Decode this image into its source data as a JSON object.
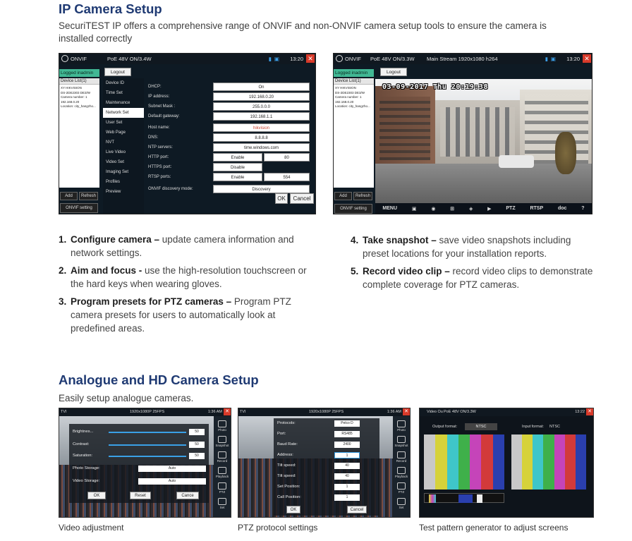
{
  "ip_section": {
    "title": "IP Camera Setup",
    "intro_line1": "SecuriTEST IP offers a comprehensive range of ONVIF and non-ONVIF camera setup tools to ensure the camera is",
    "intro_line2": "installed correctly"
  },
  "screen_left": {
    "app_name": "ONVIF",
    "poe": "PoE 48V ON/3.4W",
    "time": "13:20",
    "logged_in": "Logged inadmin",
    "logout": "Logout",
    "device_list_header": "Device List(1)",
    "device_info": [
      "XY HIKVISION",
      "DS-2DE2303 DE3/W",
      "Camera number: 1",
      "192.168.0.20",
      "Location: city_hangzho..."
    ],
    "add": "Add",
    "refresh": "Refresh",
    "onvif_setting": "ONVIF setting",
    "menu": [
      {
        "label": "Device ID"
      },
      {
        "label": "Time Set"
      },
      {
        "label": "Maintenance"
      },
      {
        "label": "Network Set"
      },
      {
        "label": "User Set"
      },
      {
        "label": "Web Page"
      },
      {
        "label": "NVT"
      },
      {
        "label": "Live Video"
      },
      {
        "label": "Video Set"
      },
      {
        "label": "Imaging Set"
      },
      {
        "label": "Profiles"
      },
      {
        "label": "Preview"
      }
    ],
    "form": {
      "dhcp_label": "DHCP:",
      "dhcp_value": "On",
      "ip_label": "IP address:",
      "ip_value": "192.168.0.20",
      "mask_label": "Subnet Mask :",
      "mask_value": "255.0.0.0",
      "gw_label": "Default gateway:",
      "gw_value": "192.168.1.1",
      "host_label": "Host name:",
      "host_value": "hikvision",
      "dns_label": "DNS:",
      "dns_value": "8.8.8.8",
      "ntp_label": "NTP servers:",
      "ntp_value": "time.windows.com",
      "http_label": "HTTP port:",
      "http_state": "Enable",
      "http_port": "80",
      "https_label": "HTTPS port:",
      "https_state": "Disable",
      "rtsp_label": "RTSP ports:",
      "rtsp_state": "Enable",
      "rtsp_port": "554",
      "disc_label": "ONVIF discovery mode:",
      "disc_value": "Discovery"
    },
    "ok": "OK",
    "cancel": "Cancel"
  },
  "screen_right": {
    "app_name": "ONVIF",
    "poe": "PoE 48V ON/3.3W",
    "stream": "Main Stream 1920x1080 h264",
    "time": "13:20",
    "logged_in": "Logged inadmin",
    "logout": "Logout",
    "device_list_header": "Device List(1)",
    "device_info": [
      "XY HIKVISION",
      "DS-2DE2303 DE3/W",
      "Camera number: 1",
      "192.168.0.20",
      "Location: city_hangzho..."
    ],
    "timestamp": "03-09-2017 Thu 20:19:38",
    "add": "Add",
    "refresh": "Refresh",
    "onvif_setting": "ONVIF setting",
    "toolbar": [
      "MENU",
      "▣",
      "◉",
      "⊞",
      "◈",
      "▶",
      "PTZ",
      "RTSP",
      "doc",
      "?"
    ]
  },
  "steps_left": [
    {
      "num": "1.",
      "title": "Configure camera –",
      "text": " update camera information and network settings."
    },
    {
      "num": "2.",
      "title": "Aim and focus -",
      "text": " use the high-resolution touchscreen or the hard keys when wearing gloves."
    },
    {
      "num": "3.",
      "title": "Program presets for PTZ cameras –",
      "text": " Program PTZ camera presets for users to automatically look at predefined areas."
    }
  ],
  "steps_right": [
    {
      "num": "4.",
      "title": "Take snapshot –",
      "text": " save video snapshots including preset locations for your installation reports."
    },
    {
      "num": "5.",
      "title": "Record video clip –",
      "text": " record video clips to demonstrate complete coverage for PTZ cameras."
    }
  ],
  "analogue_section": {
    "title": "Analogue and HD Camera Setup",
    "intro": "Easily setup analogue cameras."
  },
  "thumb1": {
    "mode": "TVI",
    "res": "1920x1080P 25FPS",
    "time": "1:36 AM",
    "rows": [
      {
        "label": "Brightnes...",
        "value": "50"
      },
      {
        "label": "Contrast:",
        "value": "50"
      },
      {
        "label": "Saturation:",
        "value": "50"
      }
    ],
    "photo_label": "Photo Storage:",
    "photo_value": "Auto",
    "video_label": "Video Storage:",
    "video_value": "Auto",
    "ok": "OK",
    "reset": "Reset",
    "cancel": "Cance",
    "side": [
      "Photo",
      "Snapshot",
      "Record",
      "Playback",
      "PTZ",
      "Set"
    ],
    "caption": "Video adjustment"
  },
  "thumb2": {
    "mode": "TVI",
    "res": "1920x1080P 25FPS",
    "time": "1:36 AM",
    "rows": [
      {
        "label": "Protocols:",
        "value": "Pelco D"
      },
      {
        "label": "Port:",
        "value": "RS485"
      },
      {
        "label": "Baud Rate:",
        "value": "2400"
      },
      {
        "label": "Address:",
        "value": "1"
      },
      {
        "label": "Tilt speed:",
        "value": "40"
      },
      {
        "label": "Tilt speed:",
        "value": "40"
      },
      {
        "label": "Set Position:",
        "value": "1"
      },
      {
        "label": "Call Position:",
        "value": "1"
      }
    ],
    "ok": "OK",
    "cancel": "Cancel",
    "side": [
      "Photo",
      "Snapshot",
      "Record",
      "Playback",
      "PTZ",
      "Set"
    ],
    "caption": "PTZ protocol settings"
  },
  "thumb3": {
    "title": "Video Ou",
    "poe": "PoE 48V ON/3.3W",
    "time": "13:22",
    "output_label": "Output format:",
    "output_value": "NTSC",
    "input_label": "Input format:",
    "input_value": "NTSC",
    "caption": "Test pattern generator to adjust screens",
    "bar_colors": [
      "#c8c8c8",
      "#d6d23a",
      "#3fc6c9",
      "#3fb04a",
      "#c544b9",
      "#d23a3a",
      "#2a3fae"
    ]
  }
}
